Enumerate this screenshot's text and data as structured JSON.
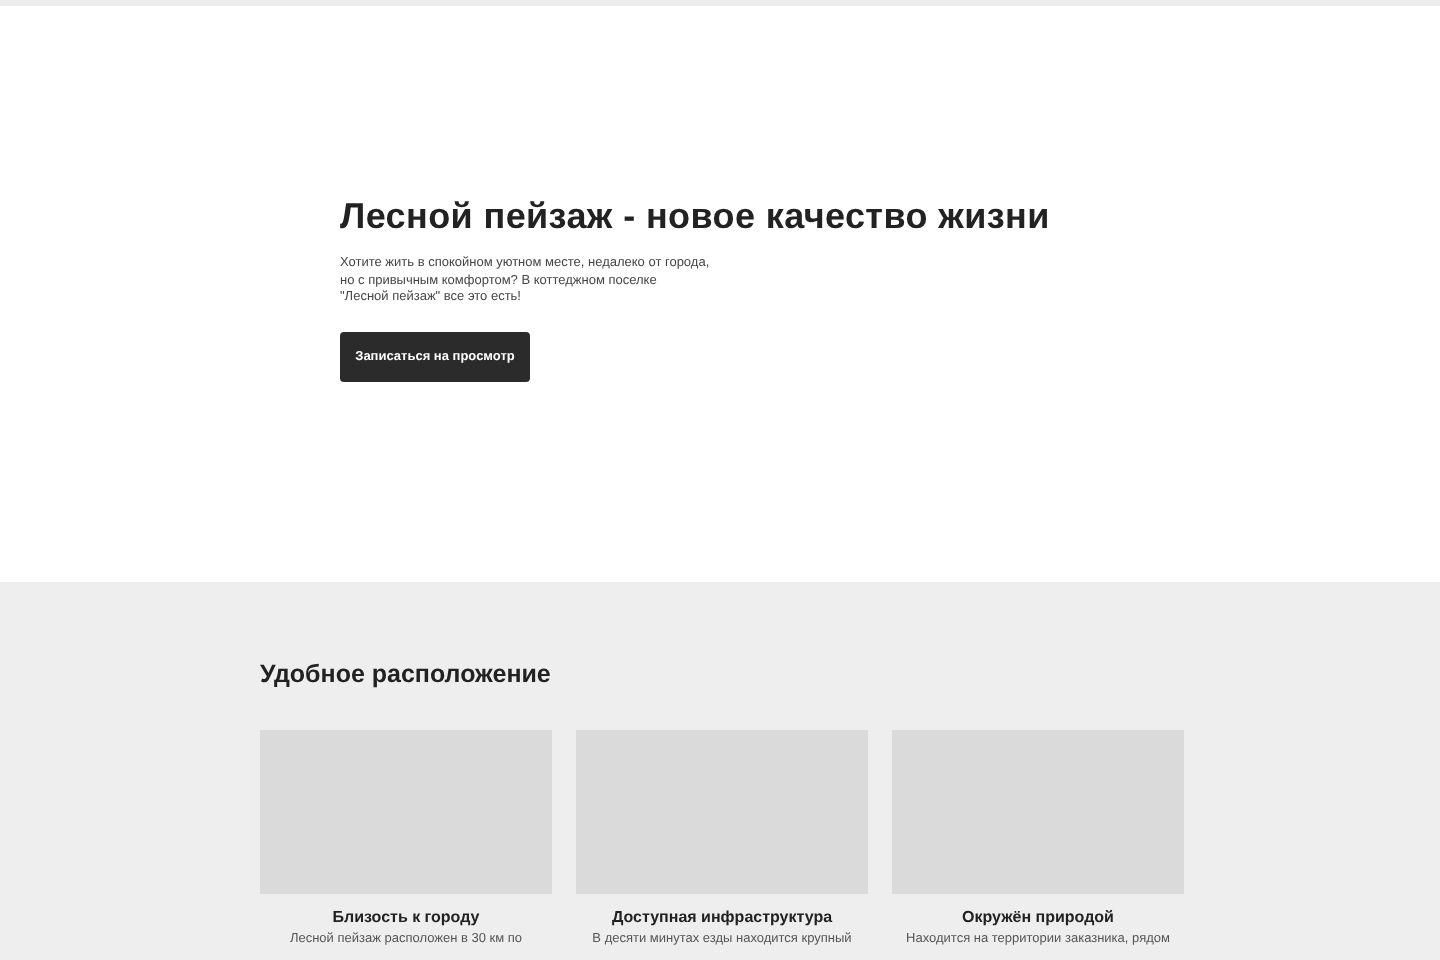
{
  "hero": {
    "title": "Лесной пейзаж - новое качество жизни",
    "lines": [
      "Хотите жить в спокойном уютном месте, недалеко от города,",
      "но с привычным комфортом? В коттеджном поселке",
      "\"Лесной пейзаж\" все это есть!"
    ],
    "button": "Записаться на просмотр"
  },
  "location": {
    "heading": "Удобное расположение",
    "cards": [
      {
        "title": "Близость к городу",
        "text": "Лесной пейзаж расположен в 30 км по"
      },
      {
        "title": "Доступная инфраструктура",
        "text": "В десяти минутах езды находится крупный"
      },
      {
        "title": "Окружён природой",
        "text": "Находится на территории заказника, рядом"
      }
    ]
  }
}
